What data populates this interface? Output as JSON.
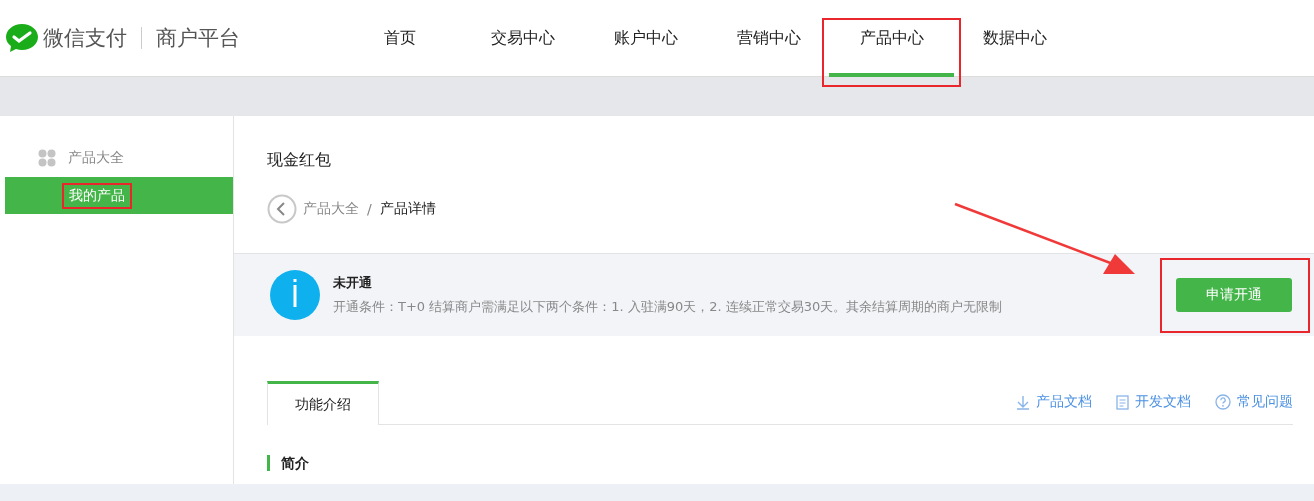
{
  "header": {
    "logo_text": "微信支付",
    "platform": "商户平台",
    "nav": [
      {
        "label": "首页",
        "selected": false,
        "highlighted": false
      },
      {
        "label": "交易中心",
        "selected": false,
        "highlighted": false
      },
      {
        "label": "账户中心",
        "selected": false,
        "highlighted": false
      },
      {
        "label": "营销中心",
        "selected": false,
        "highlighted": false
      },
      {
        "label": "产品中心",
        "selected": true,
        "highlighted": true
      },
      {
        "label": "数据中心",
        "selected": false,
        "highlighted": false
      }
    ]
  },
  "sidebar": {
    "group": "产品大全",
    "items": [
      {
        "label": "我的产品",
        "selected": true,
        "highlighted": true
      }
    ]
  },
  "main": {
    "title": "现金红包",
    "breadcrumb_separator": "/",
    "breadcrumb": [
      {
        "label": "产品大全",
        "current": false
      },
      {
        "label": "产品详情",
        "current": true
      }
    ],
    "notice": {
      "status": "未开通",
      "text": "开通条件：T+0 结算商户需满足以下两个条件：1. 入驻满90天，2. 连续正常交易30天。其余结算周期的商户无限制",
      "button": "申请开通",
      "button_highlighted": true,
      "arrow": true
    },
    "tabs": [
      {
        "label": "功能介绍",
        "selected": true
      }
    ],
    "links": [
      {
        "kind": "download",
        "label": "产品文档"
      },
      {
        "kind": "document",
        "label": "开发文档"
      },
      {
        "kind": "help",
        "label": "常见问题"
      }
    ],
    "section_title": "简介"
  }
}
